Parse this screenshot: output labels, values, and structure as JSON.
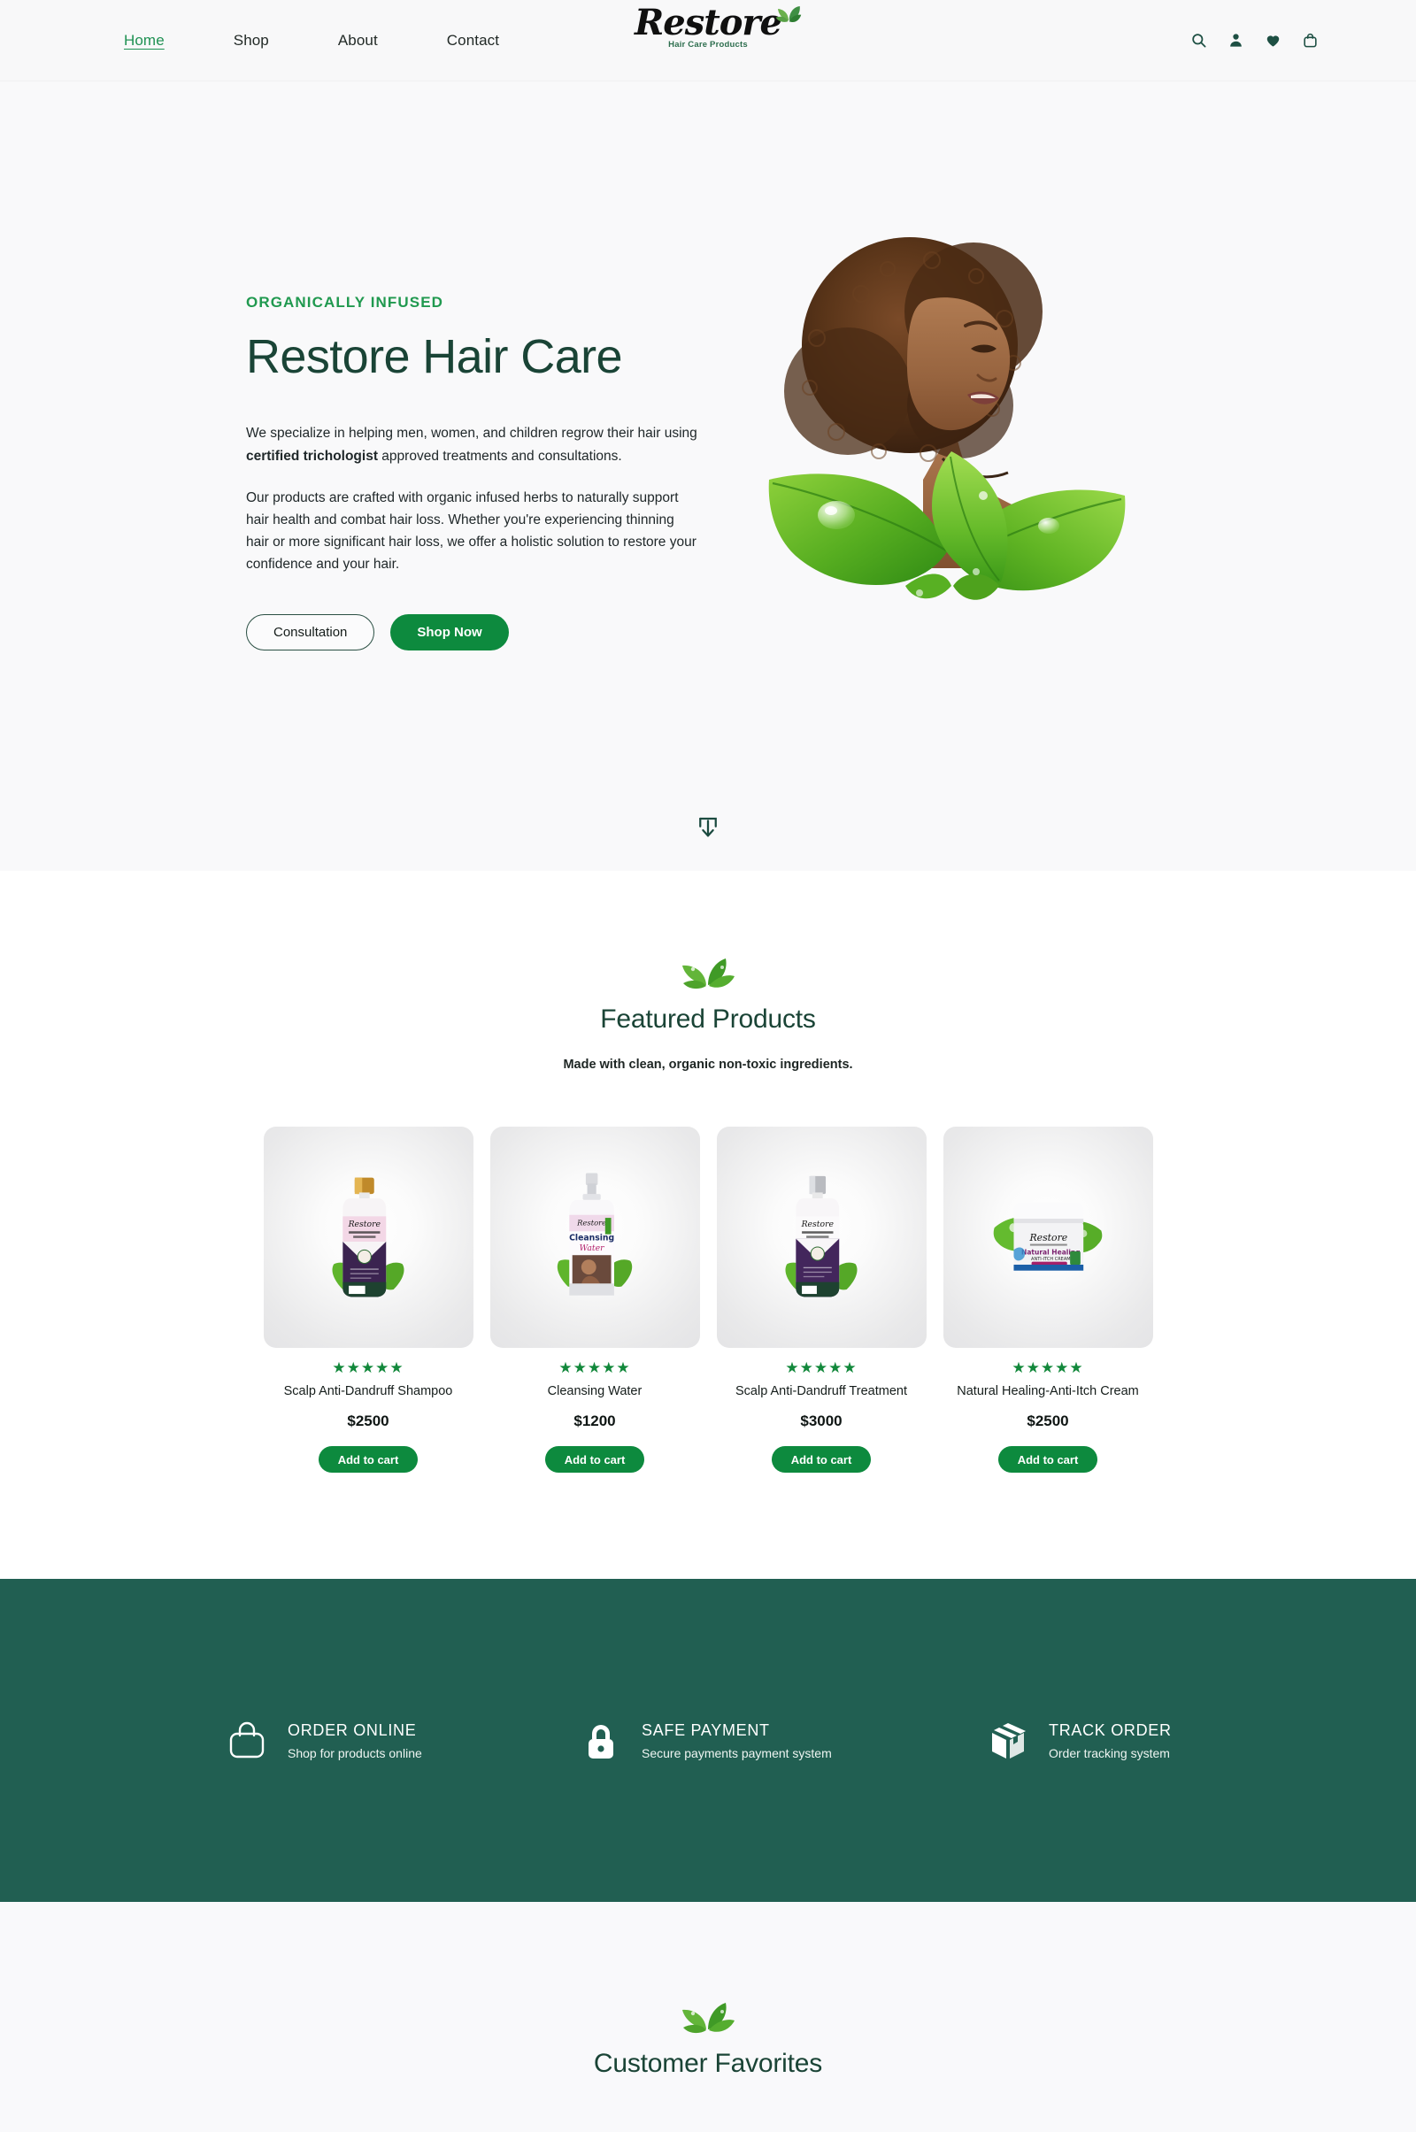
{
  "header": {
    "nav": [
      {
        "label": "Home",
        "active": true
      },
      {
        "label": "Shop",
        "active": false
      },
      {
        "label": "About",
        "active": false
      },
      {
        "label": "Contact",
        "active": false
      }
    ],
    "logo": {
      "name": "Restore",
      "tagline": "Hair Care Products"
    },
    "icons": [
      "search-icon",
      "account-icon",
      "wishlist-heart-icon",
      "shopping-bag-icon"
    ]
  },
  "hero": {
    "eyebrow": "ORGANICALLY INFUSED",
    "title": "Restore Hair Care",
    "paragraph1_a": "We specialize in helping men, women, and children regrow their hair using ",
    "paragraph1_b": "certified trichologist",
    "paragraph1_c": " approved treatments and consultations.",
    "paragraph2": "Our products are crafted with organic infused herbs to naturally support hair health and combat hair loss. Whether you're experiencing thinning hair or more significant hair loss, we offer a holistic solution to restore your confidence and your hair.",
    "btn_secondary": "Consultation",
    "btn_primary": "Shop Now",
    "scroll_icon": "scroll-down-icon"
  },
  "featured": {
    "title": "Featured Products",
    "subtitle": "Made with clean, organic non-toxic ingredients.",
    "add_to_cart_label": "Add to cart",
    "rating_stars": "★★★★★",
    "products": [
      {
        "name": "Scalp Anti-Dandruff Shampoo",
        "price": "$2500",
        "rating": 5,
        "type": "bottle-gold-cap"
      },
      {
        "name": "Cleansing Water",
        "price": "$1200",
        "rating": 5,
        "type": "spray-bottle"
      },
      {
        "name": "Scalp Anti-Dandruff Treatment",
        "price": "$3000",
        "rating": 5,
        "type": "bottle-silver-cap"
      },
      {
        "name": "Natural Healing-Anti-Itch Cream",
        "price": "$2500",
        "rating": 5,
        "type": "cream-jar"
      }
    ]
  },
  "services": [
    {
      "title": "ORDER ONLINE",
      "subtitle": "Shop for products online",
      "icon": "shopping-bag-icon"
    },
    {
      "title": "SAFE PAYMENT",
      "subtitle": "Secure payments payment system",
      "icon": "lock-icon"
    },
    {
      "title": "TRACK ORDER",
      "subtitle": "Order tracking system",
      "icon": "package-box-icon"
    }
  ],
  "favorites": {
    "title": "Customer Favorites"
  },
  "colors": {
    "brand_green": "#0d8a3e",
    "deep_green": "#1a4436",
    "band_green": "#215f52",
    "star_green": "#12883b",
    "hero_bg": "#f9f9fa"
  }
}
